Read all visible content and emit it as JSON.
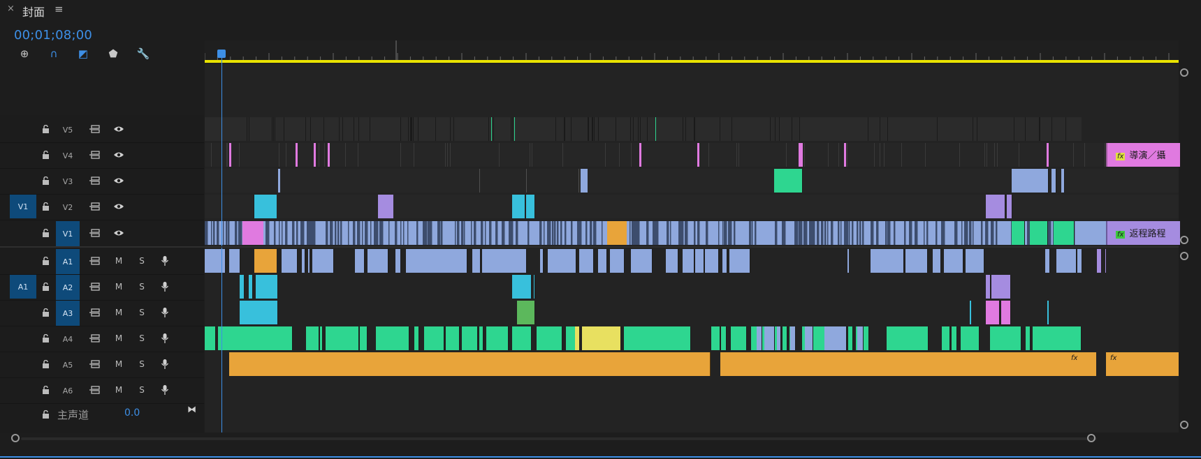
{
  "panel": {
    "close_glyph": "×",
    "title": "封面",
    "menu_glyph": "≡",
    "timecode": "00;01;08;00"
  },
  "tools": [
    {
      "name": "insert-edit-tool-icon",
      "glyph": "⊕"
    },
    {
      "name": "snap-magnet-icon",
      "glyph": "∩"
    },
    {
      "name": "linked-selection-icon",
      "glyph": "◩"
    },
    {
      "name": "add-marker-icon",
      "glyph": "⬟"
    },
    {
      "name": "wrench-settings-icon",
      "glyph": "🔧"
    }
  ],
  "colors": {
    "accent": "#3d8fe6",
    "selected": "#0e4a7a",
    "video": "#8fa8dd",
    "pink": "#e07ae0",
    "cyan": "#38c0dc",
    "green": "#2ed690",
    "orange": "#e8a43a",
    "yellow_bar": "#e9e300",
    "purple": "#a58ce0"
  },
  "tracks": [
    {
      "id": "v5",
      "label": "V5",
      "type": "video",
      "source": "",
      "targeted": false
    },
    {
      "id": "v4",
      "label": "V4",
      "type": "video",
      "source": "",
      "targeted": false
    },
    {
      "id": "v3",
      "label": "V3",
      "type": "video",
      "source": "",
      "targeted": false
    },
    {
      "id": "v2",
      "label": "V2",
      "type": "video",
      "source": "V1",
      "targeted": false
    },
    {
      "id": "v1",
      "label": "V1",
      "type": "video",
      "source": "",
      "targeted": true
    },
    {
      "id": "a1",
      "label": "A1",
      "type": "audio",
      "source": "",
      "targeted": true
    },
    {
      "id": "a2",
      "label": "A2",
      "type": "audio",
      "source": "A1",
      "targeted": true
    },
    {
      "id": "a3",
      "label": "A3",
      "type": "audio",
      "source": "",
      "targeted": true
    },
    {
      "id": "a4",
      "label": "A4",
      "type": "audio",
      "source": "",
      "targeted": false
    },
    {
      "id": "a5",
      "label": "A5",
      "type": "audio",
      "source": "",
      "targeted": false
    },
    {
      "id": "a6",
      "label": "A6",
      "type": "audio",
      "source": "",
      "targeted": false
    }
  ],
  "audio_buttons": {
    "mute": "M",
    "solo": "S"
  },
  "master": {
    "label": "主声道",
    "value": "0.0"
  },
  "clip_titles": {
    "v4_end": "導演／攝",
    "v1_end": "返程路程"
  },
  "fx_badge": "fx"
}
